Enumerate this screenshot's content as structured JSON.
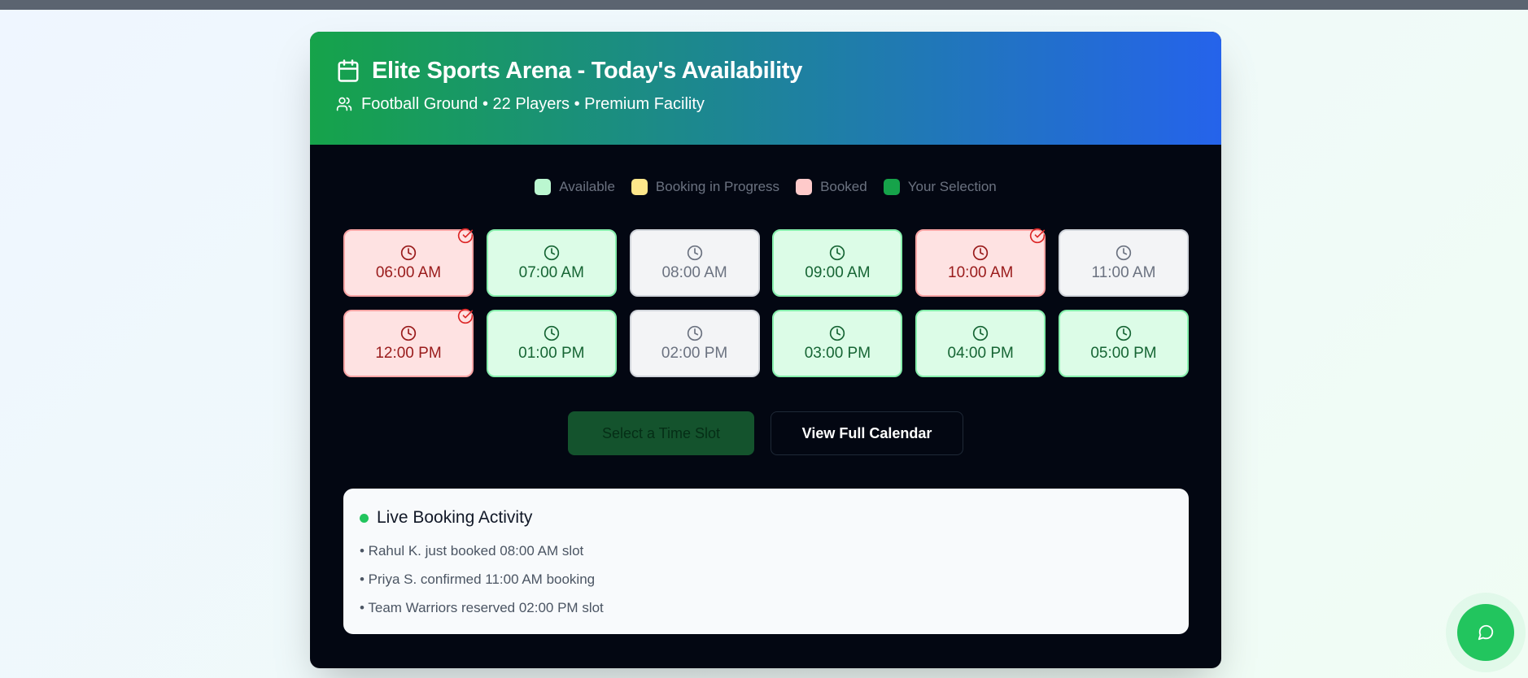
{
  "header": {
    "title": "Elite Sports Arena - Today's Availability",
    "subtitle": "Football Ground • 22 Players • Premium Facility"
  },
  "legend": [
    {
      "label": "Available",
      "color": "#bbf7d0"
    },
    {
      "label": "Booking in Progress",
      "color": "#fde68a"
    },
    {
      "label": "Booked",
      "color": "#fecaca"
    },
    {
      "label": "Your Selection",
      "color": "#16a34a"
    }
  ],
  "slots": [
    {
      "time": "06:00 AM",
      "status": "booked"
    },
    {
      "time": "07:00 AM",
      "status": "available"
    },
    {
      "time": "08:00 AM",
      "status": "unavailable"
    },
    {
      "time": "09:00 AM",
      "status": "available"
    },
    {
      "time": "10:00 AM",
      "status": "booked"
    },
    {
      "time": "11:00 AM",
      "status": "unavailable"
    },
    {
      "time": "12:00 PM",
      "status": "booked"
    },
    {
      "time": "01:00 PM",
      "status": "available"
    },
    {
      "time": "02:00 PM",
      "status": "unavailable"
    },
    {
      "time": "03:00 PM",
      "status": "available"
    },
    {
      "time": "04:00 PM",
      "status": "available"
    },
    {
      "time": "05:00 PM",
      "status": "available"
    }
  ],
  "actions": {
    "primary_label": "Select a Time Slot",
    "secondary_label": "View Full Calendar"
  },
  "activity": {
    "title": "Live Booking Activity",
    "items": [
      "• Rahul K. just booked 08:00 AM slot",
      "• Priya S. confirmed 11:00 AM booking",
      "• Team Warriors reserved 02:00 PM slot"
    ]
  },
  "icons": {
    "header": "calendar-icon",
    "subtitle": "users-icon",
    "slot": "clock-icon",
    "booked_badge": "check-circle-icon",
    "fab": "message-circle-icon"
  }
}
